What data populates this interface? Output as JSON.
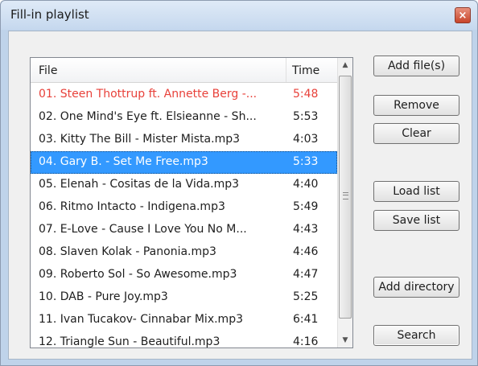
{
  "window": {
    "title": "Fill-in playlist",
    "close_symbol": "×"
  },
  "list": {
    "columns": {
      "file": "File",
      "time": "Time"
    },
    "rows": [
      {
        "file": "01. Steen Thottrup ft. Annette Berg -...",
        "time": "5:48",
        "state": "playing"
      },
      {
        "file": "02. One Mind's Eye ft. Elsieanne - Sh...",
        "time": "5:53",
        "state": "normal"
      },
      {
        "file": "03. Kitty The Bill - Mister Mista.mp3",
        "time": "4:03",
        "state": "normal"
      },
      {
        "file": "04. Gary B. - Set Me Free.mp3",
        "time": "5:33",
        "state": "selected"
      },
      {
        "file": "05. Elenah - Cositas de la Vida.mp3",
        "time": "4:40",
        "state": "normal"
      },
      {
        "file": "06. Ritmo Intacto - Indigena.mp3",
        "time": "5:49",
        "state": "normal"
      },
      {
        "file": "07. E-Love - Cause I Love You No M...",
        "time": "4:43",
        "state": "normal"
      },
      {
        "file": "08. Slaven Kolak - Panonia.mp3",
        "time": "4:46",
        "state": "normal"
      },
      {
        "file": "09. Roberto Sol - So Awesome.mp3",
        "time": "4:47",
        "state": "normal"
      },
      {
        "file": "10. DAB - Pure Joy.mp3",
        "time": "5:25",
        "state": "normal"
      },
      {
        "file": "11. Ivan Tucakov- Cinnabar Mix.mp3",
        "time": "6:41",
        "state": "normal"
      },
      {
        "file": "12. Triangle Sun - Beautiful.mp3",
        "time": "4:16",
        "state": "normal"
      }
    ]
  },
  "buttons": {
    "add_files": "Add file(s)",
    "remove": "Remove",
    "clear": "Clear",
    "load_list": "Load list",
    "save_list": "Save list",
    "add_directory": "Add directory",
    "search": "Search"
  },
  "colors": {
    "playing": "#e8413a",
    "selected_bg": "#3399ff",
    "selected_text": "#ffffff"
  }
}
